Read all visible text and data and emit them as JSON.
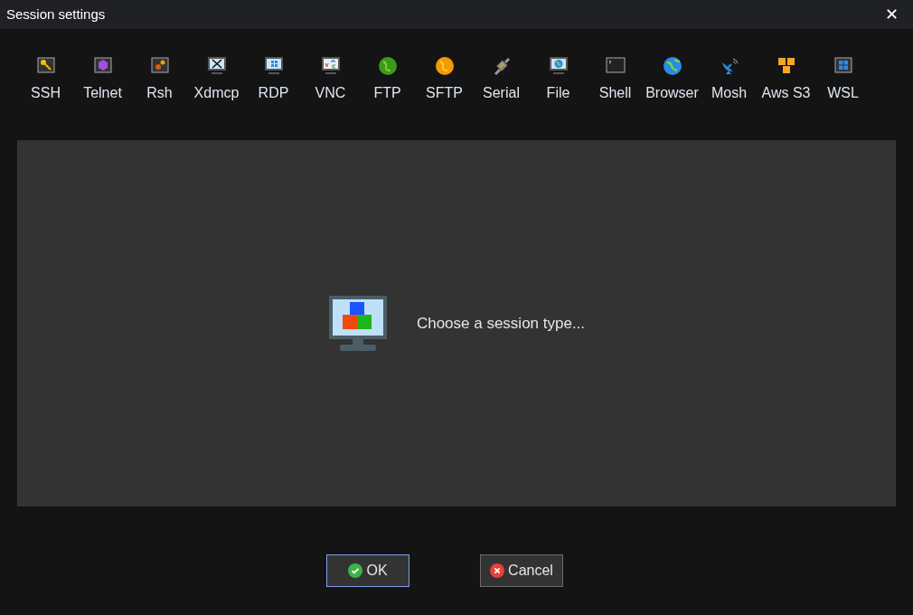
{
  "window": {
    "title": "Session settings",
    "close": "✕"
  },
  "session_types": [
    {
      "kind": "ssh",
      "label": "SSH"
    },
    {
      "kind": "telnet",
      "label": "Telnet"
    },
    {
      "kind": "rsh",
      "label": "Rsh"
    },
    {
      "kind": "xdmcp",
      "label": "Xdmcp"
    },
    {
      "kind": "rdp",
      "label": "RDP"
    },
    {
      "kind": "vnc",
      "label": "VNC"
    },
    {
      "kind": "ftp",
      "label": "FTP"
    },
    {
      "kind": "sftp",
      "label": "SFTP"
    },
    {
      "kind": "serial",
      "label": "Serial"
    },
    {
      "kind": "file",
      "label": "File"
    },
    {
      "kind": "shell",
      "label": "Shell"
    },
    {
      "kind": "browser",
      "label": "Browser"
    },
    {
      "kind": "mosh",
      "label": "Mosh"
    },
    {
      "kind": "awss3",
      "label": "Aws S3"
    },
    {
      "kind": "wsl",
      "label": "WSL"
    }
  ],
  "panel": {
    "message": "Choose a session type..."
  },
  "buttons": [
    {
      "kind": "ok",
      "label": "OK",
      "focused": true
    },
    {
      "kind": "cancel",
      "label": "Cancel",
      "focused": false
    }
  ]
}
